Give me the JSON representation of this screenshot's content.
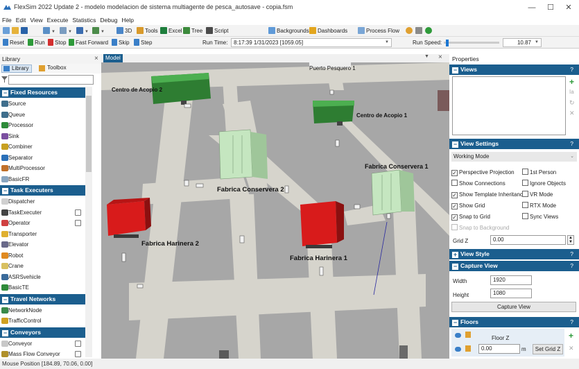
{
  "window": {
    "title": "FlexSim 2022 Update 2 - modelo modelacion de sistema multiagente  de pesca_autosave - copia.fsm",
    "minimize": "—",
    "maximize": "☐",
    "close": "✕"
  },
  "menu": [
    "File",
    "Edit",
    "View",
    "Execute",
    "Statistics",
    "Debug",
    "Help"
  ],
  "toolbar1": {
    "items": [
      "3D",
      "Tools",
      "Excel",
      "Tree",
      "Script",
      "Backgrounds",
      "Dashboards",
      "Process Flow"
    ]
  },
  "toolbar2": {
    "reset": "Reset",
    "run": "Run",
    "stop": "Stop",
    "fast_forward": "Fast Forward",
    "skip": "Skip",
    "step": "Step",
    "run_time_label": "Run Time:",
    "run_time_value": "8:17:39  1/31/2023  [1059.05]",
    "run_speed_label": "Run Speed:",
    "run_speed_value": "10.87",
    "run_speed_fraction": 0.04
  },
  "library": {
    "title": "Library",
    "close": "×",
    "tabs": [
      "Library",
      "Toolbox"
    ],
    "filter_icon": "filter-icon",
    "groups": [
      {
        "name": "Fixed Resources",
        "items": [
          "Source",
          "Queue",
          "Processor",
          "Sink",
          "Combiner",
          "Separator",
          "MultiProcessor",
          "BasicFR"
        ]
      },
      {
        "name": "Task Executers",
        "items": [
          "Dispatcher",
          "TaskExecuter",
          "Operator",
          "Transporter",
          "Elevator",
          "Robot",
          "Crane",
          "ASRSvehicle",
          "BasicTE"
        ]
      },
      {
        "name": "Travel Networks",
        "items": [
          "NetworkNode",
          "TrafficControl"
        ]
      },
      {
        "name": "Conveyors",
        "items": [
          "Conveyor",
          "Mass Flow Conveyor"
        ]
      }
    ]
  },
  "model": {
    "tab": "Model",
    "objects": {
      "puerto": "Puerto Pesquero 1",
      "acopio2": "Centro de Acopio 2",
      "acopio1": "Centro de Acopio 1",
      "conservera1": "Fabrica Conservera 1",
      "conservera2": "Fabrica Conservera 2",
      "harinera2": "Fabrica Harinera 2",
      "harinera1": "Fabrica Harinera 1"
    },
    "colors": {
      "floor": "#a7a7a7",
      "road": "#d6d4cc",
      "acopio": "#2e7d32",
      "conservera": "#c5e6c0",
      "harinera": "#d81b1b"
    }
  },
  "properties": {
    "title": "Properties",
    "views": {
      "title": "Views",
      "help": "?"
    },
    "view_settings": {
      "title": "View Settings",
      "help": "?",
      "mode": "Working Mode",
      "checks": [
        {
          "label": "Perspective Projection",
          "checked": true,
          "disabled": false
        },
        {
          "label": "1st Person",
          "checked": false,
          "disabled": false
        },
        {
          "label": "Show Connections",
          "checked": false,
          "disabled": false
        },
        {
          "label": "Ignore Objects",
          "checked": false,
          "disabled": false
        },
        {
          "label": "Show Template Inheritance",
          "checked": true,
          "disabled": false
        },
        {
          "label": "VR Mode",
          "checked": false,
          "disabled": false
        },
        {
          "label": "Show Grid",
          "checked": true,
          "disabled": false
        },
        {
          "label": "RTX Mode",
          "checked": false,
          "disabled": false
        },
        {
          "label": "Snap to Grid",
          "checked": true,
          "disabled": false
        },
        {
          "label": "Sync Views",
          "checked": false,
          "disabled": false
        },
        {
          "label": "Snap to Background",
          "checked": false,
          "disabled": true
        }
      ],
      "grid_z_label": "Grid Z",
      "grid_z_value": "0.00"
    },
    "view_style": {
      "title": "View Style",
      "help": "?"
    },
    "capture_view": {
      "title": "Capture View",
      "help": "?",
      "width_label": "Width",
      "width_value": "1920",
      "height_label": "Height",
      "height_value": "1080",
      "button": "Capture View"
    },
    "floors": {
      "title": "Floors",
      "help": "?",
      "floor_name": "Floor Z",
      "floor_value": "0.00",
      "unit": "m",
      "set_button": "Set Grid Z"
    }
  },
  "status": {
    "mouse_position": "Mouse Position [184.89, 70.06, 0.00]"
  }
}
